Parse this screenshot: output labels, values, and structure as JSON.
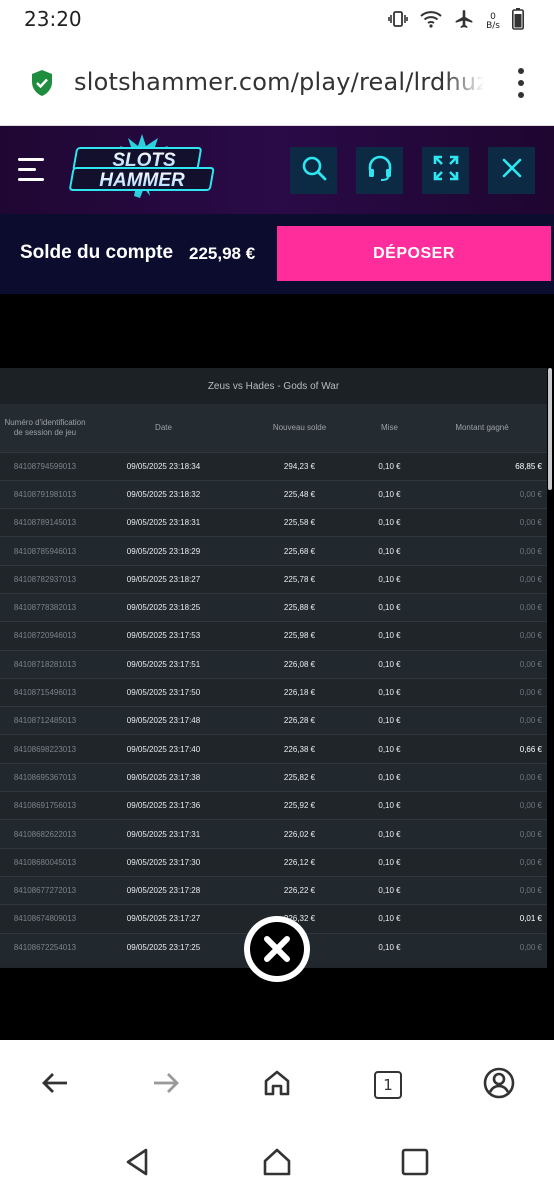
{
  "status_bar": {
    "time": "23:20",
    "net_speed_value": "0",
    "net_speed_unit": "B/s",
    "icons": [
      "vibrate-icon",
      "wifi-icon",
      "airplane-icon",
      "battery-icon"
    ]
  },
  "browser": {
    "url": "slotshammer.com/play/real/lrdhuz",
    "tab_count": "1"
  },
  "site": {
    "logo_line1": "SLOTS",
    "logo_line2": "HAMMER",
    "balance_label": "Solde du compte",
    "balance_value": "225,98 €",
    "deposit_label": "DÉPOSER",
    "colors": {
      "accent": "#ff2d9b",
      "icon_cyan": "#2ee6f0",
      "header_bg": "#2a0a47"
    }
  },
  "history": {
    "title": "Zeus vs Hades - Gods of War",
    "columns": [
      "Numéro d'identification de session de jeu",
      "Date",
      "Nouveau solde",
      "Mise",
      "Montant gagné"
    ],
    "rows": [
      [
        "84108794599013",
        "09/05/2025 23:18:34",
        "294,23 €",
        "0,10 €",
        "68,85 €"
      ],
      [
        "84108791981013",
        "09/05/2025 23:18:32",
        "225,48 €",
        "0,10 €",
        "0,00 €"
      ],
      [
        "84108789145013",
        "09/05/2025 23:18:31",
        "225,58 €",
        "0,10 €",
        "0,00 €"
      ],
      [
        "84108785946013",
        "09/05/2025 23:18:29",
        "225,68 €",
        "0,10 €",
        "0,00 €"
      ],
      [
        "84108782937013",
        "09/05/2025 23:18:27",
        "225,78 €",
        "0,10 €",
        "0,00 €"
      ],
      [
        "84108778382013",
        "09/05/2025 23:18:25",
        "225,88 €",
        "0,10 €",
        "0,00 €"
      ],
      [
        "84108720946013",
        "09/05/2025 23:17:53",
        "225,98 €",
        "0,10 €",
        "0,00 €"
      ],
      [
        "84108718281013",
        "09/05/2025 23:17:51",
        "226,08 €",
        "0,10 €",
        "0,00 €"
      ],
      [
        "84108715496013",
        "09/05/2025 23:17:50",
        "226,18 €",
        "0,10 €",
        "0,00 €"
      ],
      [
        "84108712485013",
        "09/05/2025 23:17:48",
        "226,28 €",
        "0,10 €",
        "0,00 €"
      ],
      [
        "84108698223013",
        "09/05/2025 23:17:40",
        "226,38 €",
        "0,10 €",
        "0,66 €"
      ],
      [
        "84108695367013",
        "09/05/2025 23:17:38",
        "225,82 €",
        "0,10 €",
        "0,00 €"
      ],
      [
        "84108691756013",
        "09/05/2025 23:17:36",
        "225,92 €",
        "0,10 €",
        "0,00 €"
      ],
      [
        "84108682622013",
        "09/05/2025 23:17:31",
        "226,02 €",
        "0,10 €",
        "0,00 €"
      ],
      [
        "84108680045013",
        "09/05/2025 23:17:30",
        "226,12 €",
        "0,10 €",
        "0,00 €"
      ],
      [
        "84108677272013",
        "09/05/2025 23:17:28",
        "226,22 €",
        "0,10 €",
        "0,00 €"
      ],
      [
        "84108674809013",
        "09/05/2025 23:17:27",
        "226,32 €",
        "0,10 €",
        "0,01 €"
      ],
      [
        "84108672254013",
        "09/05/2025 23:17:25",
        "€",
        "0,10 €",
        "0,00 €"
      ]
    ],
    "highlight_nonzero_win": true
  }
}
